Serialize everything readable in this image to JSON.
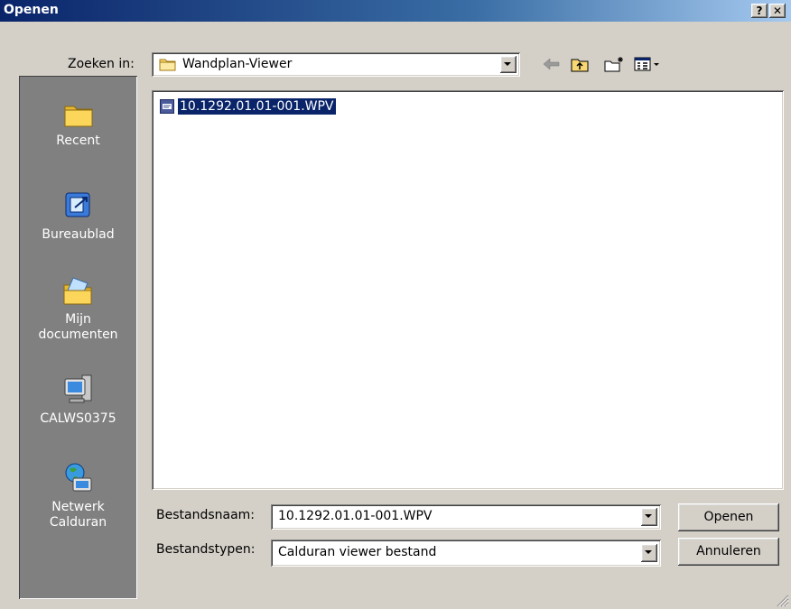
{
  "window": {
    "title": "Openen",
    "help_button": "?",
    "close_button": "✕"
  },
  "lookin": {
    "label": "Zoeken in:",
    "value": "Wandplan-Viewer"
  },
  "toolbar": {
    "back": "back-icon",
    "up": "up-folder-icon",
    "new_folder": "new-folder-icon",
    "view_menu": "view-menu-icon"
  },
  "places": [
    {
      "label": "Recent",
      "icon": "recent-folder-icon"
    },
    {
      "label": "Bureaublad",
      "icon": "desktop-icon"
    },
    {
      "label": "Mijn\ndocumenten",
      "icon": "my-documents-icon"
    },
    {
      "label": "CALWS0375",
      "icon": "my-computer-icon"
    },
    {
      "label": "Netwerk\nCalduran",
      "icon": "network-icon"
    }
  ],
  "files": [
    {
      "name": "10.1292.01.01-001.WPV",
      "icon": "wpv-file-icon",
      "selected": true
    }
  ],
  "filename": {
    "label": "Bestandsnaam:",
    "value": "10.1292.01.01-001.WPV"
  },
  "filetype": {
    "label": "Bestandstypen:",
    "value": "Calduran viewer bestand"
  },
  "buttons": {
    "open": "Openen",
    "cancel": "Annuleren"
  },
  "colors": {
    "titlebar_start": "#0a246a",
    "titlebar_end": "#a6caf0",
    "dialog_bg": "#d4d0c8",
    "places_bg": "#808080",
    "selection": "#0a246a"
  }
}
